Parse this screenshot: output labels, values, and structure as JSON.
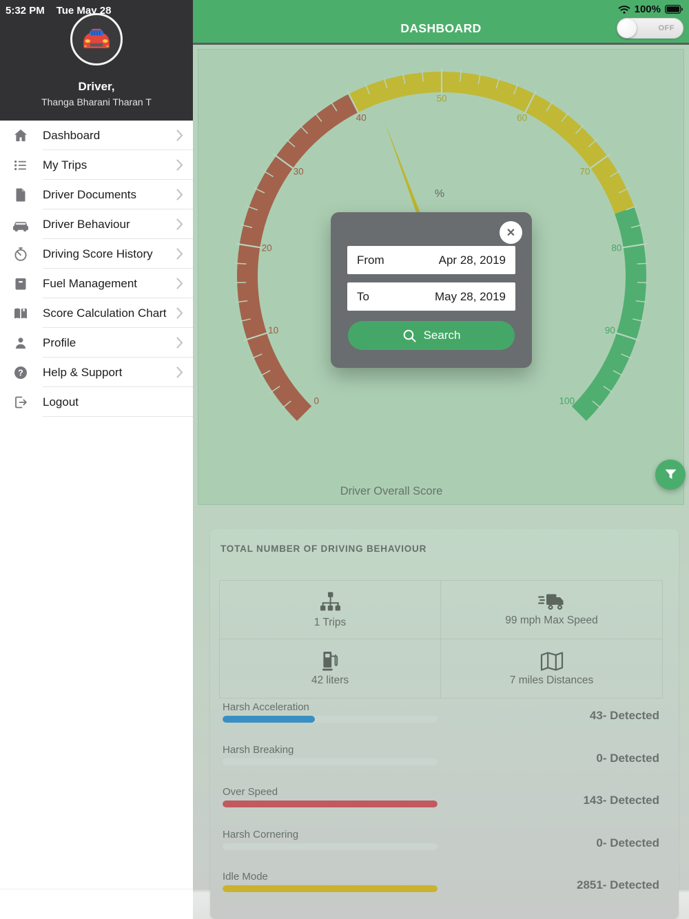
{
  "status_bar": {
    "time": "5:32 PM",
    "date": "Tue May 28",
    "battery_percent": "100%"
  },
  "sidebar": {
    "profile": {
      "title": "Driver,",
      "name": "Thanga Bharani Tharan T"
    },
    "items": [
      {
        "label": "Dashboard",
        "icon": "home-icon"
      },
      {
        "label": "My Trips",
        "icon": "list-icon"
      },
      {
        "label": "Driver Documents",
        "icon": "document-icon"
      },
      {
        "label": "Driver Behaviour",
        "icon": "car-icon"
      },
      {
        "label": "Driving Score History",
        "icon": "history-icon"
      },
      {
        "label": "Fuel Management",
        "icon": "fuel-box-icon"
      },
      {
        "label": "Score Calculation Chart",
        "icon": "book-icon"
      },
      {
        "label": "Profile",
        "icon": "person-icon"
      },
      {
        "label": "Help & Support",
        "icon": "help-icon"
      },
      {
        "label": "Logout",
        "icon": "logout-icon"
      }
    ]
  },
  "header": {
    "title": "DASHBOARD",
    "toggle": {
      "label": "OFF",
      "state": "off"
    },
    "accent_green": "#4cae6b"
  },
  "gauge": {
    "caption": "Driver Overall Score",
    "center_label": "%",
    "center_label_color": "#5f6b64",
    "center_label_pos": [
      350,
      214
    ],
    "min": 0,
    "max": 100,
    "start_angle": 135,
    "sweep": 270,
    "center": [
      353,
      329
    ],
    "radius": 282,
    "band_width": 30,
    "label_radius": 257,
    "major_step": 10,
    "minor_step": 2,
    "tick_color": "#b7d4bd",
    "needle_value": 42.5,
    "needle_length": 240,
    "needle_half_width": 4.5,
    "needle_color": "#bdb42f",
    "segments": [
      {
        "from": 0,
        "to": 40,
        "color": "#a3624c"
      },
      {
        "from": 40,
        "to": 76,
        "color": "#c1b836"
      },
      {
        "from": 76,
        "to": 100,
        "color": "#50ae70"
      }
    ],
    "tick_labels": [
      {
        "value": 0,
        "label": "0",
        "color": "#9d5b43"
      },
      {
        "value": 10,
        "label": "10",
        "color": "#9d5b43"
      },
      {
        "value": 20,
        "label": "20",
        "color": "#9d5b43"
      },
      {
        "value": 30,
        "label": "30",
        "color": "#9d5b43"
      },
      {
        "value": 40,
        "label": "40",
        "color": "#9d5b43"
      },
      {
        "value": 50,
        "label": "50",
        "color": "#aaa32c"
      },
      {
        "value": 60,
        "label": "60",
        "color": "#aaa32c"
      },
      {
        "value": 70,
        "label": "70",
        "color": "#a0a02e"
      },
      {
        "value": 80,
        "label": "80",
        "color": "#48a467"
      },
      {
        "value": 90,
        "label": "90",
        "color": "#48a467"
      },
      {
        "value": 100,
        "label": "100",
        "color": "#48a467"
      }
    ]
  },
  "modal": {
    "from_label": "From",
    "from_value": "Apr 28, 2019",
    "to_label": "To",
    "to_value": "May 28, 2019",
    "search_label": "Search"
  },
  "summary": {
    "title": "TOTAL NUMBER OF DRIVING BEHAVIOUR",
    "cells": [
      {
        "icon": "trips-icon",
        "label": "1 Trips"
      },
      {
        "icon": "truck-icon",
        "label": "99 mph Max Speed"
      },
      {
        "icon": "fuel-pump-icon",
        "label": "42 liters"
      },
      {
        "icon": "map-icon",
        "label": "7 miles Distances"
      }
    ]
  },
  "behaviour_bars": [
    {
      "label": "Harsh Acceleration",
      "detected": "43- Detected",
      "percent": 43,
      "color": "#3a8fc2"
    },
    {
      "label": "Harsh Breaking",
      "detected": "0- Detected",
      "percent": 0,
      "color": "#3a8fc2"
    },
    {
      "label": "Over Speed",
      "detected": "143- Detected",
      "percent": 100,
      "color": "#c05a5e"
    },
    {
      "label": "Harsh Cornering",
      "detected": "0- Detected",
      "percent": 0,
      "color": "#c05a5e"
    },
    {
      "label": "Idle Mode",
      "detected": "2851- Detected",
      "percent": 100,
      "color": "#cab22f"
    }
  ]
}
